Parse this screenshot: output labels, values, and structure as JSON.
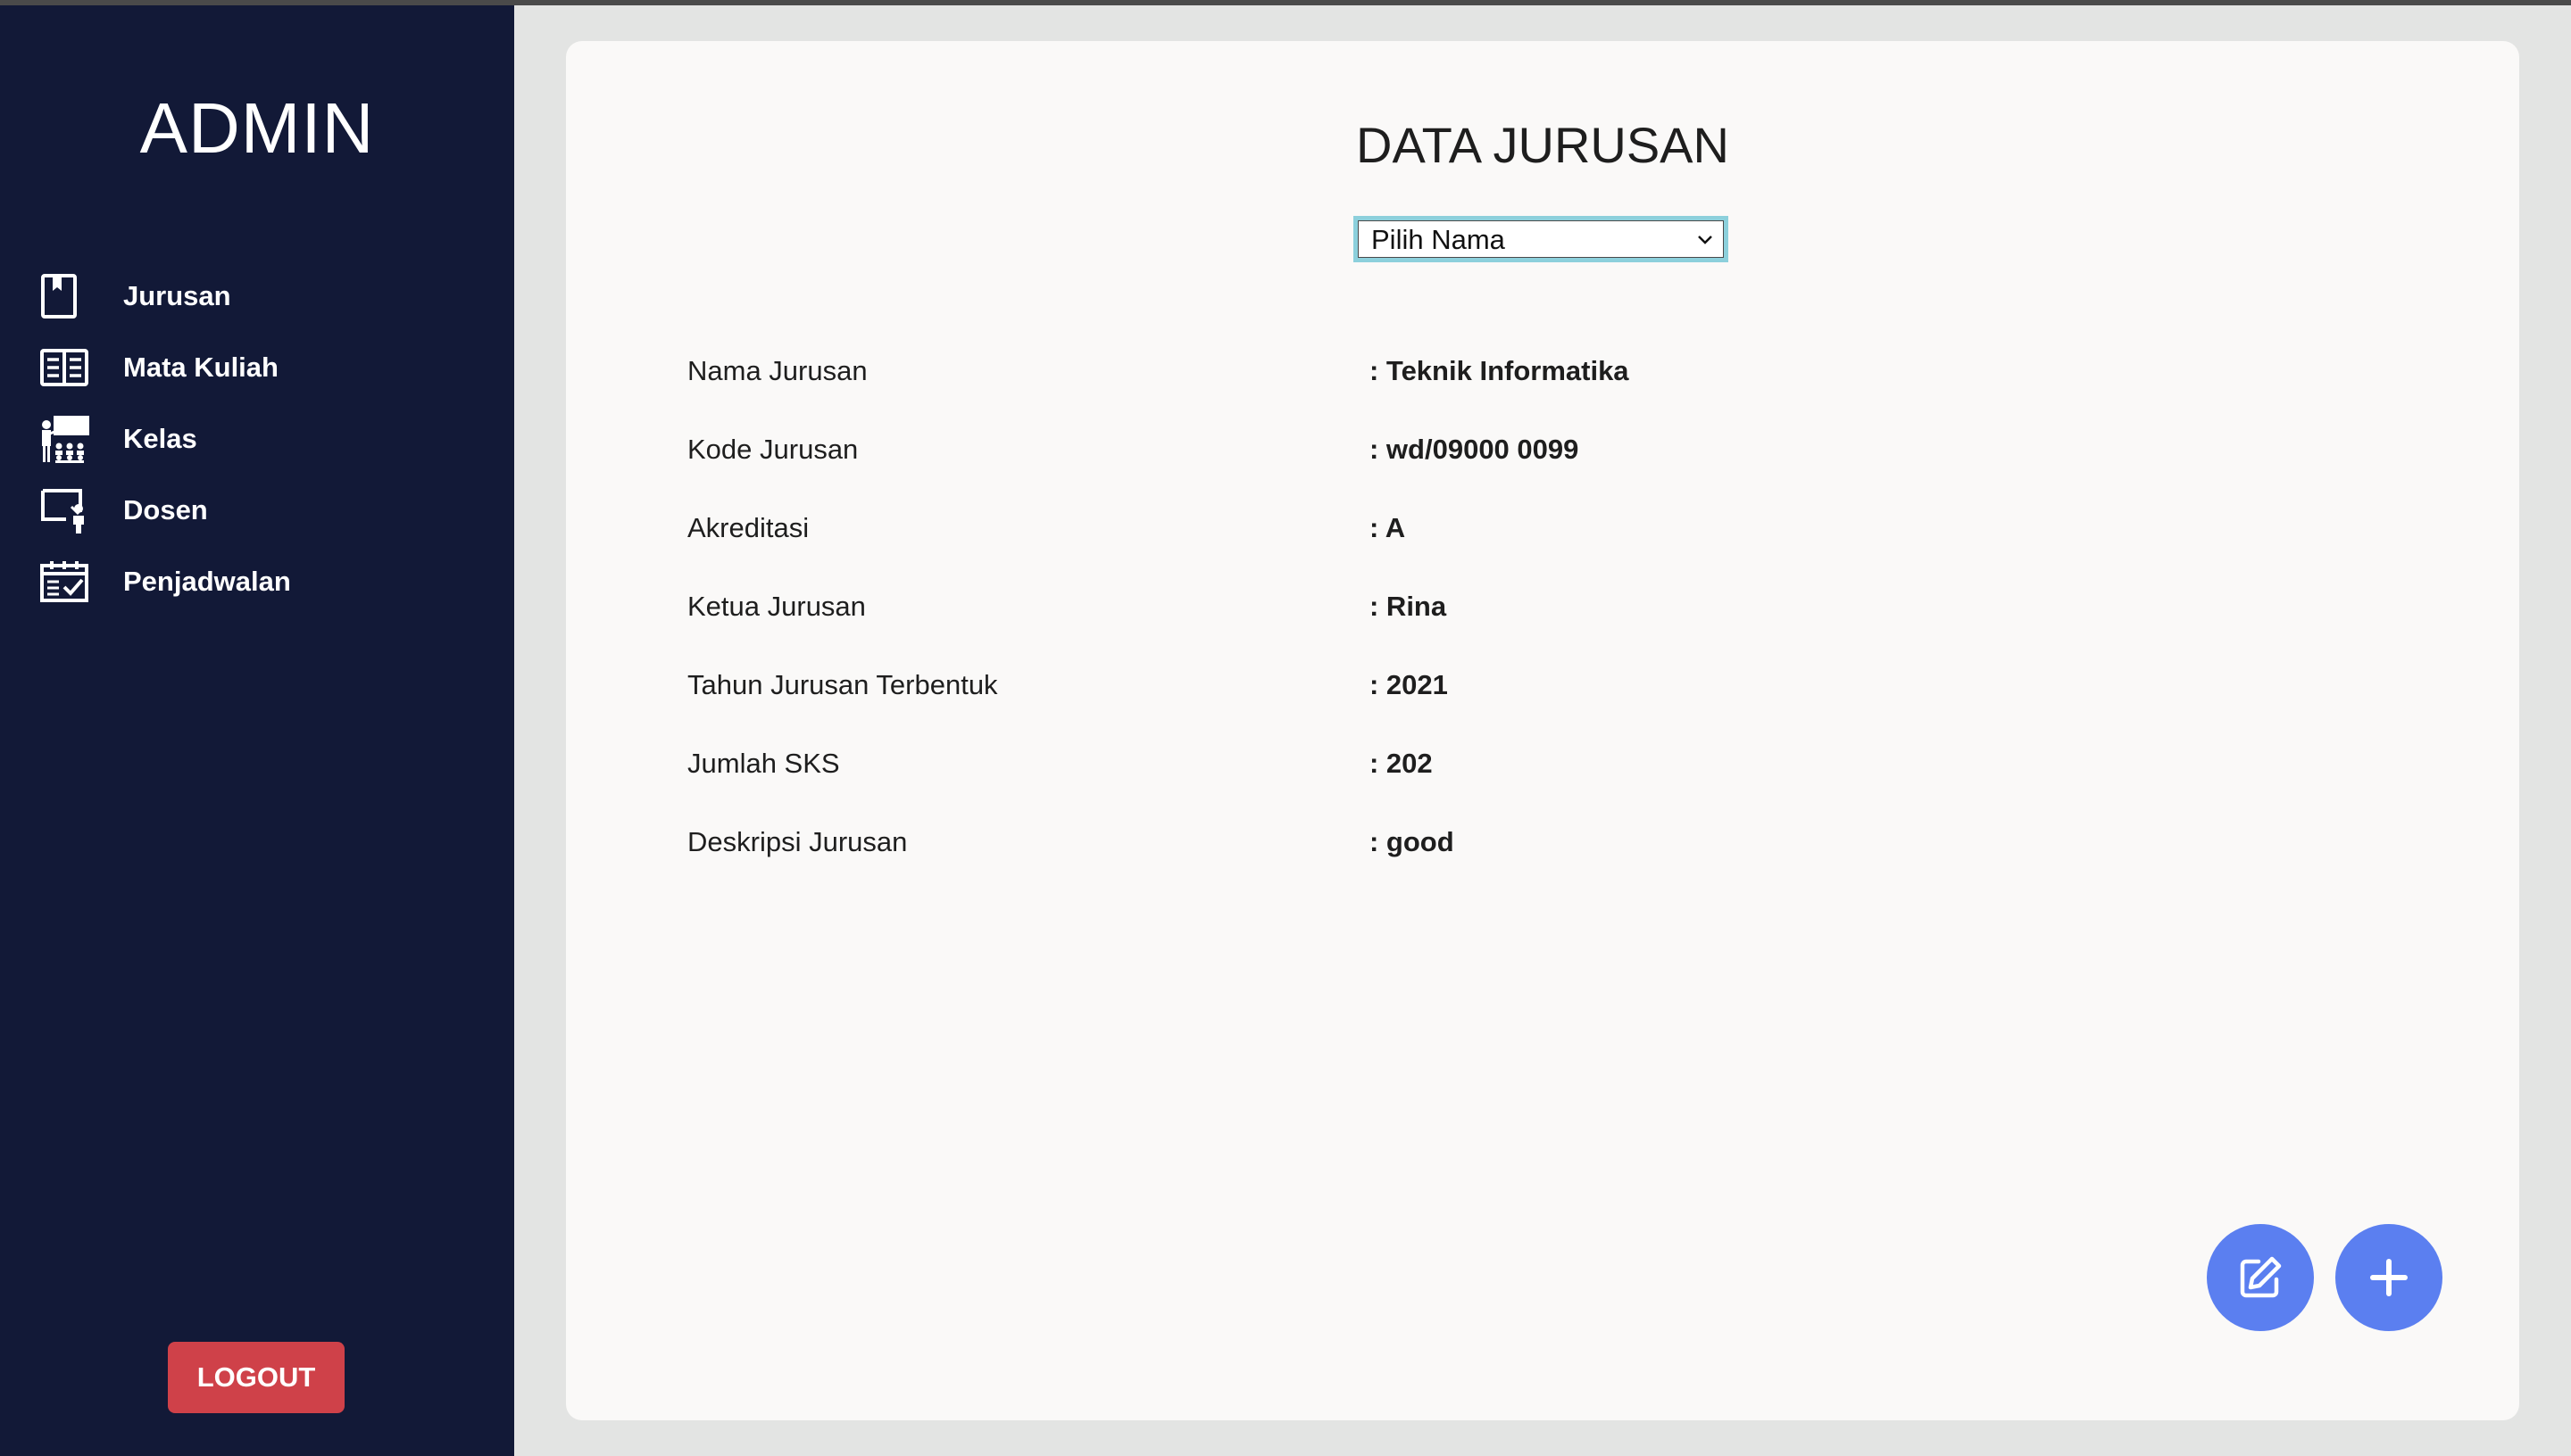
{
  "sidebar": {
    "brand": "ADMIN",
    "items": [
      {
        "label": "Jurusan",
        "icon": "bookmark-book-icon"
      },
      {
        "label": "Mata Kuliah",
        "icon": "newspaper-icon"
      },
      {
        "label": "Kelas",
        "icon": "classroom-icon"
      },
      {
        "label": "Dosen",
        "icon": "lecturer-board-icon"
      },
      {
        "label": "Penjadwalan",
        "icon": "calendar-check-icon"
      }
    ],
    "logout_label": "LOGOUT"
  },
  "main": {
    "title": "DATA JURUSAN",
    "select": {
      "selected": "Pilih Nama"
    },
    "fields": [
      {
        "label": "Nama Jurusan",
        "value": ": Teknik Informatika"
      },
      {
        "label": "Kode Jurusan",
        "value": ": wd/09000 0099"
      },
      {
        "label": "Akreditasi",
        "value": ": A"
      },
      {
        "label": "Ketua Jurusan",
        "value": ": Rina"
      },
      {
        "label": "Tahun Jurusan Terbentuk",
        "value": ": 2021"
      },
      {
        "label": "Jumlah SKS",
        "value": ": 202"
      },
      {
        "label": "Deskripsi Jurusan",
        "value": ": good"
      }
    ],
    "actions": {
      "edit_icon": "edit-icon",
      "add_icon": "plus-icon"
    }
  },
  "colors": {
    "sidebar_bg": "#121937",
    "logout_bg": "#cf4149",
    "fab_bg": "#5b7ff0",
    "select_focus": "#8cd0dc",
    "page_bg": "#e3e4e3",
    "card_bg": "#faf9f8"
  }
}
